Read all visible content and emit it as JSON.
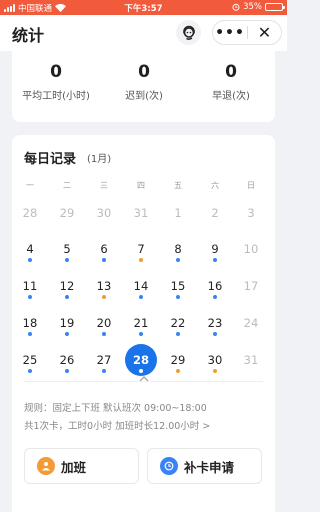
{
  "status_bar": {
    "carrier": "中国联通",
    "time": "下午3:57",
    "battery": "35%",
    "battery_level": 0.35,
    "bg_color": "#f25a3c"
  },
  "header": {
    "title": "统计",
    "help_icon": "customer-service-icon",
    "more_icon": "more-dots-icon",
    "close_icon": "close-icon",
    "more_label": "•••",
    "close_label": "✕"
  },
  "stats": [
    {
      "value": "0",
      "label": "平均工时(小时)"
    },
    {
      "value": "0",
      "label": "迟到(次)"
    },
    {
      "value": "0",
      "label": "早退(次)"
    }
  ],
  "daily": {
    "title": "每日记录",
    "month": "(1月)",
    "weekdays": [
      "一",
      "二",
      "三",
      "四",
      "五",
      "六",
      "日"
    ],
    "weeks": [
      [
        {
          "d": "28",
          "muted": true,
          "dot": ""
        },
        {
          "d": "29",
          "muted": true,
          "dot": ""
        },
        {
          "d": "30",
          "muted": true,
          "dot": ""
        },
        {
          "d": "31",
          "muted": true,
          "dot": ""
        },
        {
          "d": "1",
          "muted": true,
          "dot": ""
        },
        {
          "d": "2",
          "muted": true,
          "dot": ""
        },
        {
          "d": "3",
          "muted": true,
          "dot": ""
        }
      ],
      [
        {
          "d": "4",
          "muted": false,
          "dot": "blue"
        },
        {
          "d": "5",
          "muted": false,
          "dot": "blue"
        },
        {
          "d": "6",
          "muted": false,
          "dot": "blue"
        },
        {
          "d": "7",
          "muted": false,
          "dot": "orange"
        },
        {
          "d": "8",
          "muted": false,
          "dot": "blue"
        },
        {
          "d": "9",
          "muted": false,
          "dot": "blue"
        },
        {
          "d": "10",
          "muted": true,
          "dot": ""
        }
      ],
      [
        {
          "d": "11",
          "muted": false,
          "dot": "blue"
        },
        {
          "d": "12",
          "muted": false,
          "dot": "blue"
        },
        {
          "d": "13",
          "muted": false,
          "dot": "orange"
        },
        {
          "d": "14",
          "muted": false,
          "dot": "blue"
        },
        {
          "d": "15",
          "muted": false,
          "dot": "blue"
        },
        {
          "d": "16",
          "muted": false,
          "dot": "blue"
        },
        {
          "d": "17",
          "muted": true,
          "dot": ""
        }
      ],
      [
        {
          "d": "18",
          "muted": false,
          "dot": "blue"
        },
        {
          "d": "19",
          "muted": false,
          "dot": "blue"
        },
        {
          "d": "20",
          "muted": false,
          "dot": "blue"
        },
        {
          "d": "21",
          "muted": false,
          "dot": "blue"
        },
        {
          "d": "22",
          "muted": false,
          "dot": "blue"
        },
        {
          "d": "23",
          "muted": false,
          "dot": "blue"
        },
        {
          "d": "24",
          "muted": true,
          "dot": ""
        }
      ],
      [
        {
          "d": "25",
          "muted": false,
          "dot": "blue"
        },
        {
          "d": "26",
          "muted": false,
          "dot": "blue"
        },
        {
          "d": "27",
          "muted": false,
          "dot": "blue"
        },
        {
          "d": "28",
          "muted": false,
          "dot": "white",
          "today": true
        },
        {
          "d": "29",
          "muted": false,
          "dot": "orange"
        },
        {
          "d": "30",
          "muted": false,
          "dot": "orange"
        },
        {
          "d": "31",
          "muted": true,
          "dot": ""
        }
      ]
    ],
    "rule_text": "规则：固定上下班 默认班次 09:00~18:00",
    "summary_text": "共1次卡，工时0小时 加班时长12.00小时 >",
    "overtime_button": {
      "label": "加班",
      "icon": "overtime-icon",
      "color": "#f29b38"
    },
    "makeup_button": {
      "label": "补卡申请",
      "icon": "clock-icon",
      "color": "#3b82f6"
    }
  },
  "colors": {
    "accent_blue": "#1a73e8",
    "dot_blue": "#3b82f6",
    "dot_orange": "#f29b38"
  }
}
